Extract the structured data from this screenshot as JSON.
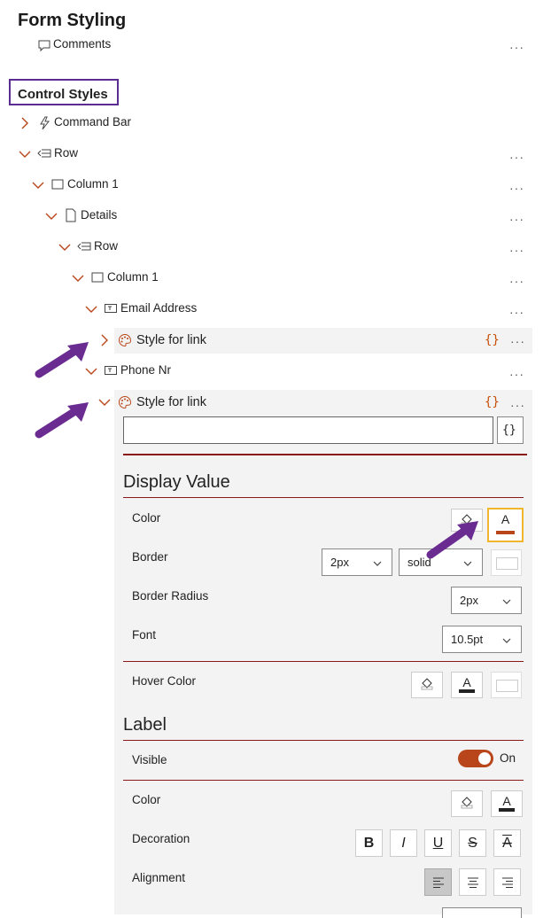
{
  "header": {
    "title": "Form Styling"
  },
  "tree": {
    "comments_label": "Comments",
    "section_label": "Control Styles",
    "items": [
      {
        "label": "Command Bar"
      },
      {
        "label": "Row"
      },
      {
        "label": "Column 1"
      },
      {
        "label": "Details"
      },
      {
        "label": "Row"
      },
      {
        "label": "Column 1"
      },
      {
        "label": "Email Address"
      },
      {
        "label": "Style for link"
      },
      {
        "label": "Phone Nr"
      },
      {
        "label": "Style for link"
      }
    ],
    "more_glyph": "···",
    "braces_glyph": "{}"
  },
  "editor": {
    "expression_value": "",
    "expression_button": "{}"
  },
  "display_value": {
    "title": "Display Value",
    "color_label": "Color",
    "text_color_glyph": "A",
    "text_color": "#b9461a",
    "border_label": "Border",
    "border_width": "2px",
    "border_style": "solid",
    "border_radius_label": "Border Radius",
    "border_radius": "2px",
    "font_label": "Font",
    "font_size": "10.5pt",
    "hover_color_label": "Hover Color",
    "hover_text_glyph": "A"
  },
  "label_section": {
    "title": "Label",
    "visible_label": "Visible",
    "visible_state": "On",
    "color_label": "Color",
    "text_color_glyph": "A",
    "decoration_label": "Decoration",
    "decorations": [
      "B",
      "I",
      "U",
      "S",
      "A"
    ],
    "alignment_label": "Alignment"
  },
  "colors": {
    "accent": "#b9461a",
    "divider": "#8a1a1a",
    "annotation": "#6a2c91",
    "highlight_border": "#f2b52e"
  }
}
